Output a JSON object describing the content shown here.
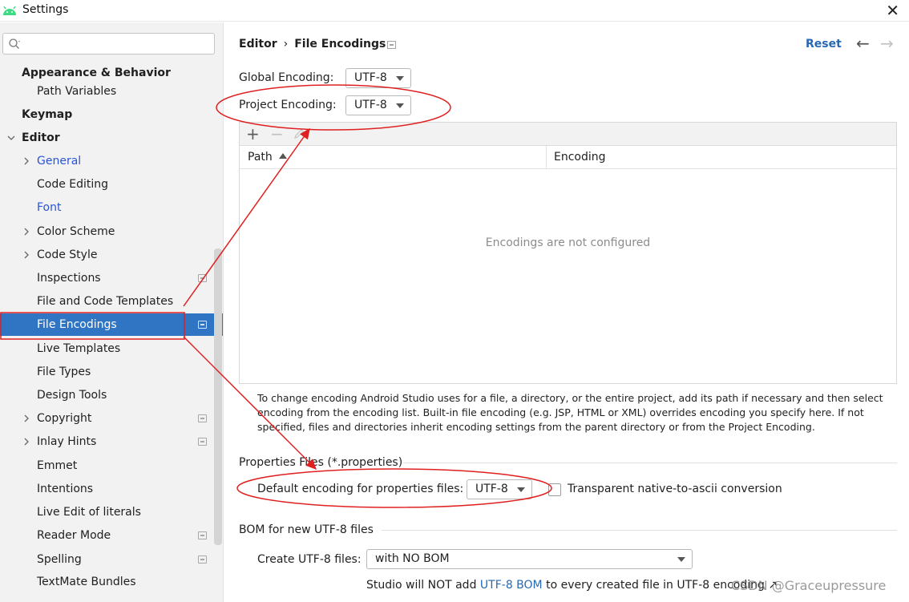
{
  "window": {
    "title": "Settings"
  },
  "sidebar": {
    "search_placeholder": "",
    "items": [
      {
        "label": "Appearance & Behavior"
      },
      {
        "label": "Path Variables"
      },
      {
        "label": "Keymap"
      },
      {
        "label": "Editor"
      },
      {
        "label": "General"
      },
      {
        "label": "Code Editing"
      },
      {
        "label": "Font"
      },
      {
        "label": "Color Scheme"
      },
      {
        "label": "Code Style"
      },
      {
        "label": "Inspections"
      },
      {
        "label": "File and Code Templates"
      },
      {
        "label": "File Encodings"
      },
      {
        "label": "Live Templates"
      },
      {
        "label": "File Types"
      },
      {
        "label": "Design Tools"
      },
      {
        "label": "Copyright"
      },
      {
        "label": "Inlay Hints"
      },
      {
        "label": "Emmet"
      },
      {
        "label": "Intentions"
      },
      {
        "label": "Live Edit of literals"
      },
      {
        "label": "Reader Mode"
      },
      {
        "label": "Spelling"
      },
      {
        "label": "TextMate Bundles"
      }
    ],
    "selected": "File Encodings"
  },
  "header": {
    "breadcrumb_parent": "Editor",
    "breadcrumb_separator": "›",
    "breadcrumb_current": "File Encodings",
    "reset_label": "Reset",
    "back_icon": "←",
    "forward_icon": "→"
  },
  "encodings": {
    "global_label": "Global Encoding:",
    "global_value": "UTF-8",
    "project_label": "Project Encoding:",
    "project_value": "UTF-8"
  },
  "table": {
    "add_icon": "+",
    "remove_icon": "−",
    "columns": [
      "Path",
      "Encoding"
    ],
    "empty_text": "Encodings are not configured"
  },
  "help_text": "To change encoding Android Studio uses for a file, a directory, or the entire project, add its path if necessary and then select encoding from the encoding list. Built-in file encoding (e.g. JSP, HTML or XML) overrides encoding you specify here. If not specified, files and directories inherit encoding settings from the parent directory or from the Project Encoding.",
  "properties": {
    "section_title": "Properties Files (*.properties)",
    "default_label": "Default encoding for properties files:",
    "default_value": "UTF-8",
    "transparent_label": "Transparent native-to-ascii conversion",
    "transparent_checked": false
  },
  "bom": {
    "section_title": "BOM for new UTF-8 files",
    "create_label": "Create UTF-8 files:",
    "create_value": "with NO BOM",
    "note_prefix": "Studio will NOT add ",
    "note_link": "UTF-8 BOM",
    "note_suffix": " to every created file in UTF-8 encoding ↗"
  },
  "watermark": "CSDN @Graceupressure",
  "colors": {
    "selection": "#2f75c3",
    "link": "#2768b3",
    "annotation": "#e02020",
    "android_green": "#3ddc84"
  }
}
